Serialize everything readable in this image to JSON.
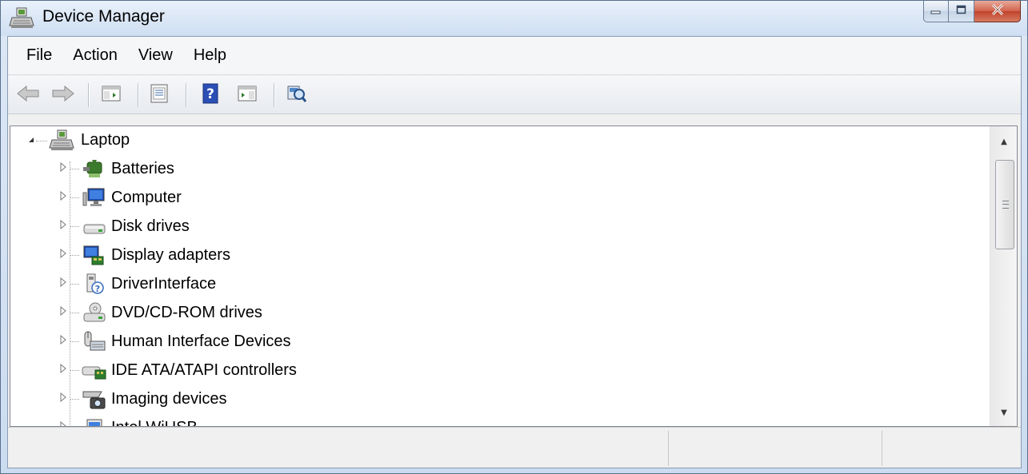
{
  "window": {
    "title": "Device Manager",
    "controls": {
      "minimize": "minimize",
      "maximize": "maximize",
      "close": "close"
    }
  },
  "menubar": {
    "items": [
      {
        "label": "File"
      },
      {
        "label": "Action"
      },
      {
        "label": "View"
      },
      {
        "label": "Help"
      }
    ]
  },
  "toolbar": {
    "buttons": [
      {
        "icon": "back-arrow-icon"
      },
      {
        "icon": "forward-arrow-icon"
      },
      {
        "icon": "show-hide-console-tree-icon"
      },
      {
        "icon": "properties-icon"
      },
      {
        "icon": "help-icon"
      },
      {
        "icon": "show-hide-action-pane-icon"
      },
      {
        "icon": "scan-hardware-changes-icon"
      }
    ]
  },
  "tree": {
    "root": {
      "label": "Laptop",
      "icon": "computer-icon",
      "expanded": true
    },
    "children": [
      {
        "label": "Batteries",
        "icon": "battery-icon"
      },
      {
        "label": "Computer",
        "icon": "monitor-icon"
      },
      {
        "label": "Disk drives",
        "icon": "disk-drive-icon"
      },
      {
        "label": "Display adapters",
        "icon": "display-adapter-icon"
      },
      {
        "label": "DriverInterface",
        "icon": "unknown-device-icon"
      },
      {
        "label": "DVD/CD-ROM drives",
        "icon": "dvd-drive-icon"
      },
      {
        "label": "Human Interface Devices",
        "icon": "hid-icon"
      },
      {
        "label": "IDE ATA/ATAPI controllers",
        "icon": "ide-controller-icon"
      },
      {
        "label": "Imaging devices",
        "icon": "camera-icon"
      },
      {
        "label": "Intel WiUSB",
        "icon": "usb-icon"
      }
    ]
  },
  "colors": {
    "titlebar": "#dbe7f6",
    "close_button": "#c7432c",
    "tree_background": "#ffffff"
  }
}
